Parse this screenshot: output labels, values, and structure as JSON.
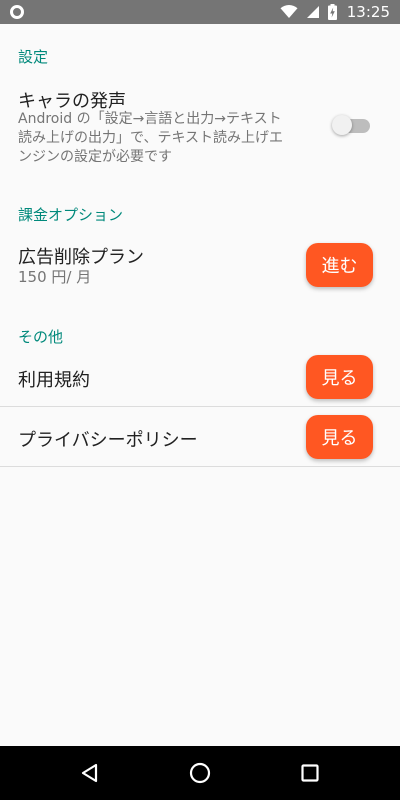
{
  "status_bar": {
    "time": "13:25",
    "left_icon": "circle-notification-icon",
    "icons": [
      "wifi-icon",
      "cellular-signal-icon",
      "battery-charging-icon"
    ]
  },
  "sections": {
    "settings": {
      "header": "設定",
      "voice": {
        "title": "キャラの発声",
        "summary_line1": "Android の「設定→言語と出力→テキスト",
        "summary_line2": "読み上げの出力」で、テキスト読み上げエ",
        "summary_line3": "ンジンの設定が必要です",
        "toggle_on": false
      }
    },
    "billing": {
      "header": "課金オプション",
      "ad_removal": {
        "title": "広告削除プラン",
        "price": "150 円/ 月",
        "button": "進む"
      }
    },
    "other": {
      "header": "その他",
      "terms": {
        "title": "利用規約",
        "button": "見る"
      },
      "privacy": {
        "title": "プライバシーポリシー",
        "button": "見る"
      }
    }
  },
  "colors": {
    "accent": "#00897b",
    "button": "#ff5722",
    "status_bar": "#757575",
    "nav_bar": "#000000"
  },
  "nav_bar": {
    "icons": [
      "back-icon",
      "home-icon",
      "recents-icon"
    ]
  }
}
